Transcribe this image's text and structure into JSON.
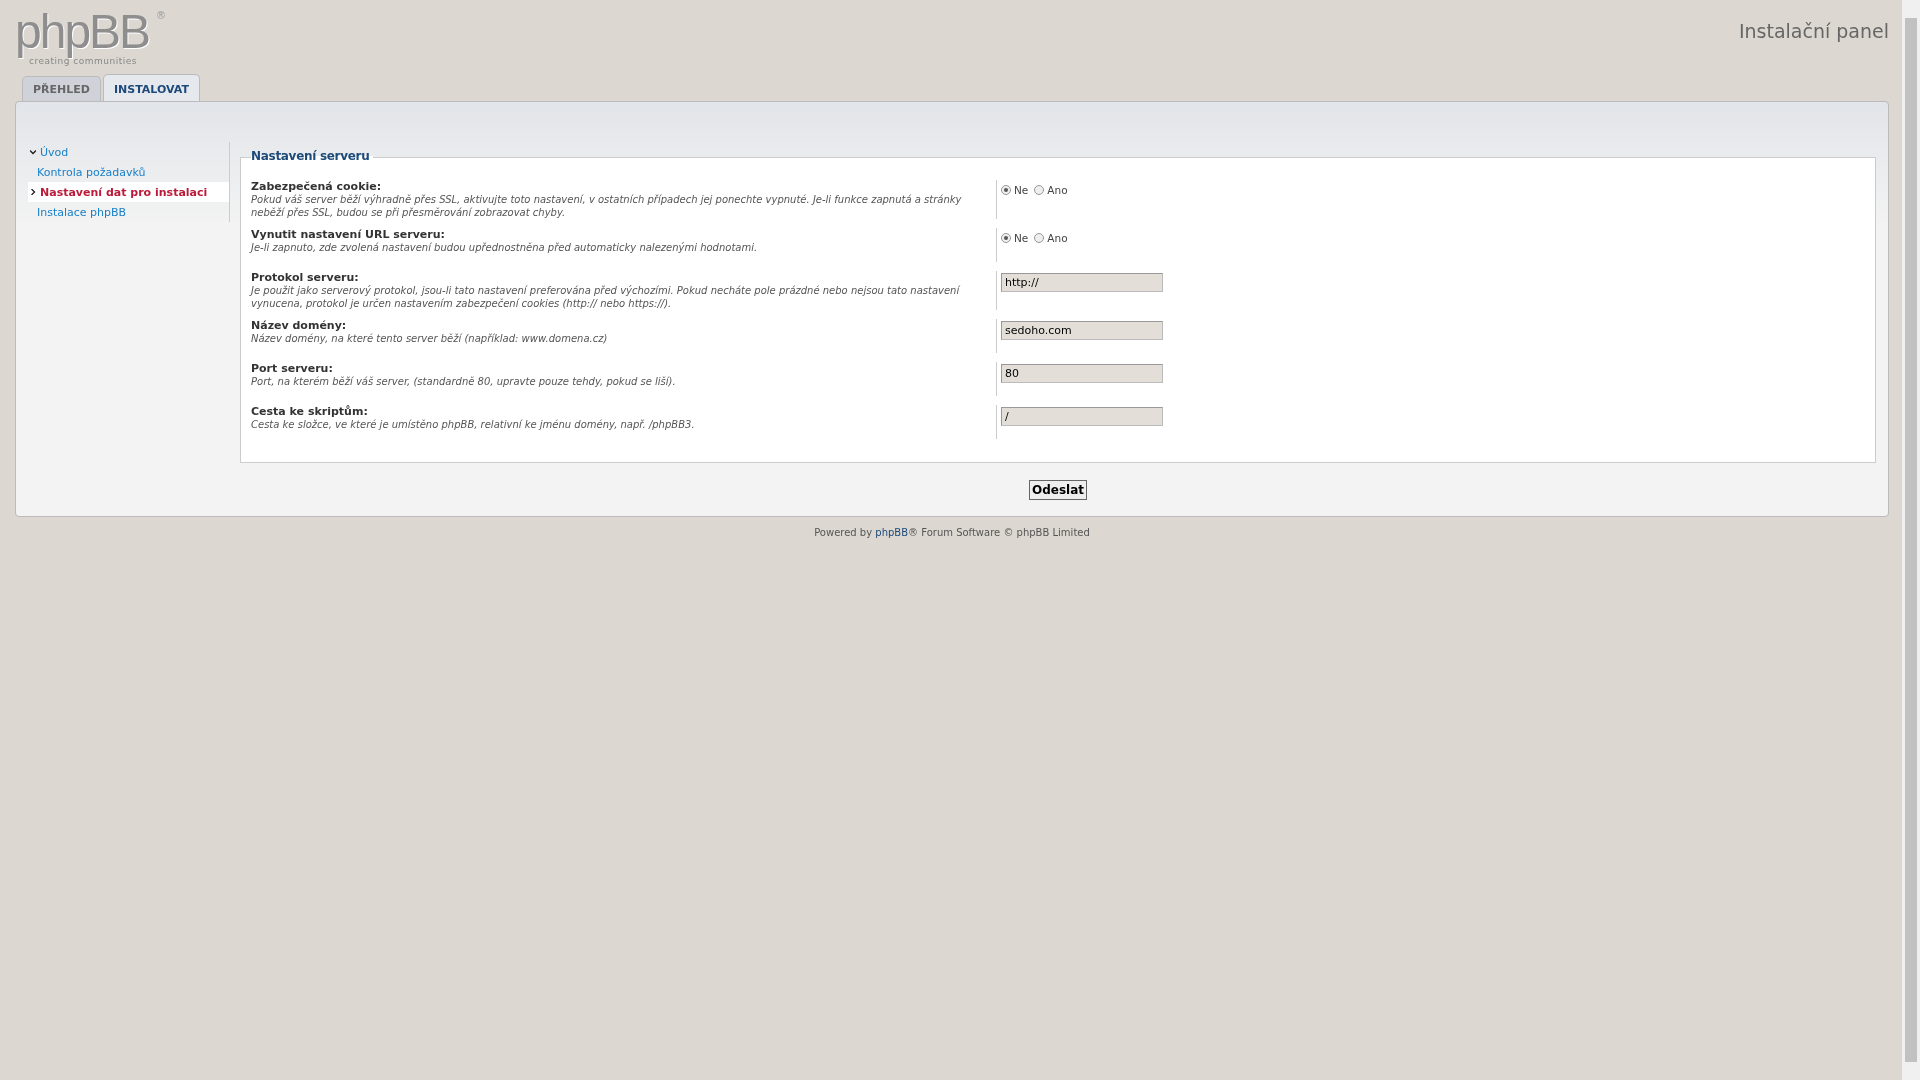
{
  "logo": {
    "name": "phpBB",
    "mark": "®",
    "tagline": "creating communities"
  },
  "header": {
    "title": "Instalační panel"
  },
  "tabs": [
    {
      "label": "PŘEHLED",
      "selected": false
    },
    {
      "label": "INSTALOVAT",
      "selected": true
    }
  ],
  "sidebar": {
    "items": [
      {
        "label": "Úvod",
        "kind": "section",
        "selected": false
      },
      {
        "label": "Kontrola požadavků",
        "kind": "step",
        "selected": false
      },
      {
        "label": "Nastavení dat pro instalaci",
        "kind": "step",
        "selected": true
      },
      {
        "label": "Instalace phpBB",
        "kind": "step",
        "selected": false
      }
    ]
  },
  "form": {
    "legend": "Nastavení serveru",
    "fields": [
      {
        "kind": "radio",
        "label": "Zabezpečená cookie:",
        "explain": "Pokud váš server běží výhradně přes SSL, aktivujte toto nastavení, v ostatních případech jej ponechte vypnuté. Je-li funkce zapnutá a stránky neběží přes SSL, budou se při přesměrování zobrazovat chyby.",
        "options": [
          {
            "label": "Ne",
            "selected": true
          },
          {
            "label": "Ano",
            "selected": false
          }
        ]
      },
      {
        "kind": "radio",
        "label": "Vynutit nastavení URL serveru:",
        "explain": "Je-li zapnuto, zde zvolená nastavení budou upřednostněna před automaticky nalezenými hodnotami.",
        "options": [
          {
            "label": "Ne",
            "selected": true
          },
          {
            "label": "Ano",
            "selected": false
          }
        ]
      },
      {
        "kind": "text",
        "label": "Protokol serveru:",
        "explain": "Je použit jako serverový protokol, jsou-li tato nastavení preferována před výchozími. Pokud necháte pole prázdné nebo nejsou tato nastavení vynucena, protokol je určen nastavením zabezpečení cookies (http:// nebo https://).",
        "value": "http://"
      },
      {
        "kind": "text",
        "label": "Název domény:",
        "explain": "Název domény, na které tento server běží (například: www.domena.cz)",
        "value": "sedoho.com"
      },
      {
        "kind": "text",
        "label": "Port serveru:",
        "explain": "Port, na kterém běží váš server, (standardně 80, upravte pouze tehdy, pokud se liší).",
        "value": "80"
      },
      {
        "kind": "text",
        "label": "Cesta ke skriptům:",
        "explain": "Cesta ke složce, ve které je umístěno phpBB, relativní ke jménu domény, např. /phpBB3.",
        "value": "/"
      }
    ],
    "submit": "Odeslat"
  },
  "footer": {
    "before": "Powered by",
    "link": "phpBB",
    "after": "® Forum Software © phpBB Limited"
  }
}
